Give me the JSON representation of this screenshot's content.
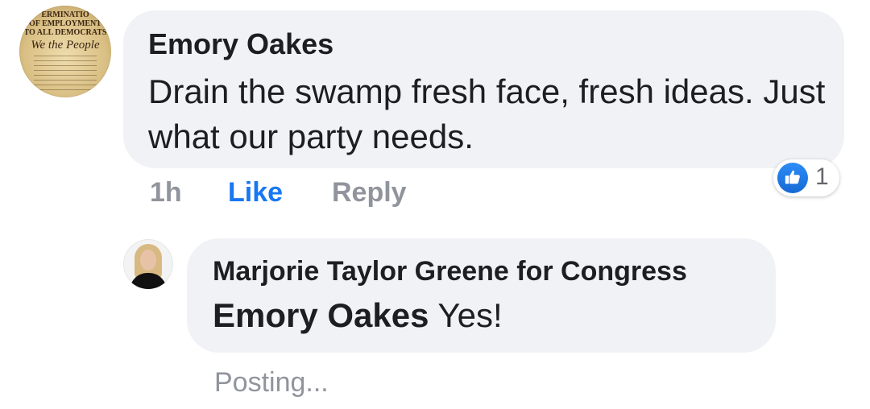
{
  "comment": {
    "avatar_text": {
      "line1": "ERMINATIO",
      "line2": "OF EMPLOYMENT",
      "line3": "TO ALL DEMOCRATS",
      "script": "We the People"
    },
    "author": "Emory Oakes",
    "text": "Drain the swamp fresh face, fresh ideas. Just what our party needs.",
    "time": "1h",
    "like_label": "Like",
    "reply_label": "Reply",
    "reaction": {
      "icon": "thumbs-up-icon",
      "count": "1",
      "color": "#1877f2"
    }
  },
  "reply": {
    "author": "Marjorie Taylor Greene for Congress",
    "mention": "Emory Oakes",
    "text": "Yes!",
    "status": "Posting..."
  },
  "colors": {
    "bubble": "#f0f2f5",
    "link": "#1877f2",
    "muted": "#90949c",
    "text": "#1c1e21"
  }
}
